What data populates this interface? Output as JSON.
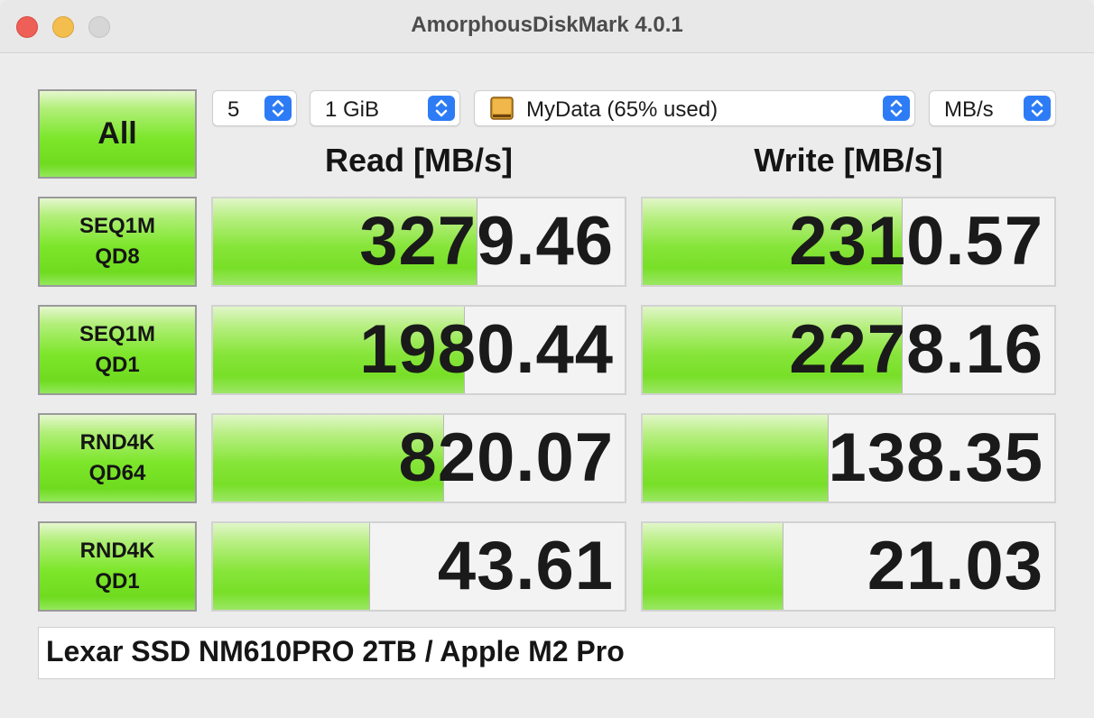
{
  "window": {
    "title": "AmorphousDiskMark 4.0.1"
  },
  "controls": {
    "all_button": "All",
    "count": "5",
    "size": "1 GiB",
    "volume": "MyData (65% used)",
    "unit": "MB/s"
  },
  "headers": {
    "read": "Read [MB/s]",
    "write": "Write [MB/s]"
  },
  "tests": [
    {
      "line1": "SEQ1M",
      "line2": "QD8",
      "read": "3279.46",
      "write": "2310.57",
      "read_fill_percent": 64,
      "write_fill_percent": 63
    },
    {
      "line1": "SEQ1M",
      "line2": "QD1",
      "read": "1980.44",
      "write": "2278.16",
      "read_fill_percent": 61,
      "write_fill_percent": 63
    },
    {
      "line1": "RND4K",
      "line2": "QD64",
      "read": "820.07",
      "write": "138.35",
      "read_fill_percent": 56,
      "write_fill_percent": 45
    },
    {
      "line1": "RND4K",
      "line2": "QD1",
      "read": "43.61",
      "write": "21.03",
      "read_fill_percent": 38,
      "write_fill_percent": 34
    }
  ],
  "comment": "Lexar SSD NM610PRO 2TB / Apple M2 Pro"
}
